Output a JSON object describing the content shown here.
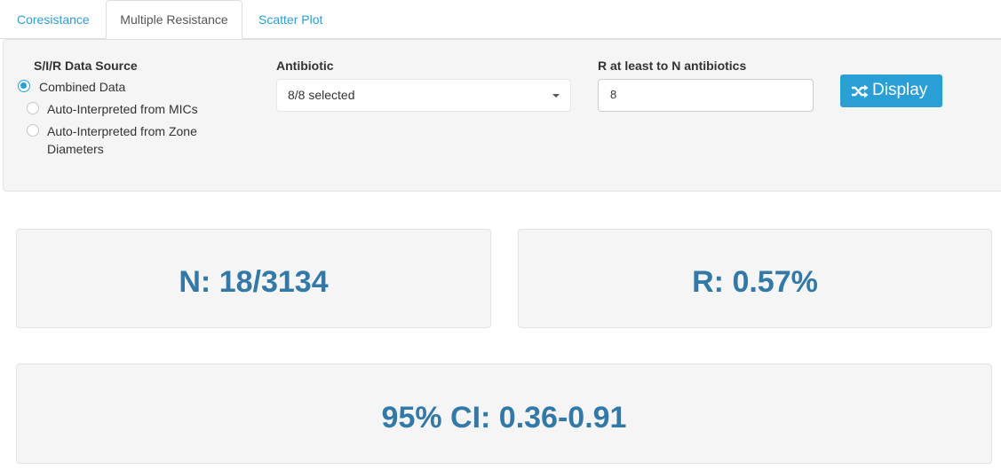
{
  "tabs": [
    {
      "label": "Coresistance",
      "active": false
    },
    {
      "label": "Multiple Resistance",
      "active": true
    },
    {
      "label": "Scatter Plot",
      "active": false
    }
  ],
  "controls": {
    "data_source_label": "S/I/R Data Source",
    "data_source_options": [
      {
        "label": "Combined Data",
        "checked": true
      },
      {
        "label": "Auto-Interpreted from MICs",
        "checked": false
      },
      {
        "label_line1": "Auto-Interpreted from Zone",
        "label_line2": "Diameters",
        "checked": false
      }
    ],
    "antibiotic_label": "Antibiotic",
    "antibiotic_value": "8/8 selected",
    "r_at_least_label": "R at least to N antibiotics",
    "r_at_least_value": "8",
    "display_button": "Display",
    "display_icon": "shuffle-icon"
  },
  "results": {
    "n": "N: 18/3134",
    "r": "R: 0.57%",
    "ci": "95% CI: 0.36-0.91"
  },
  "colors": {
    "accent": "#2a9fd6",
    "stat_text": "#3279a8",
    "panel_bg": "#f5f5f5"
  }
}
